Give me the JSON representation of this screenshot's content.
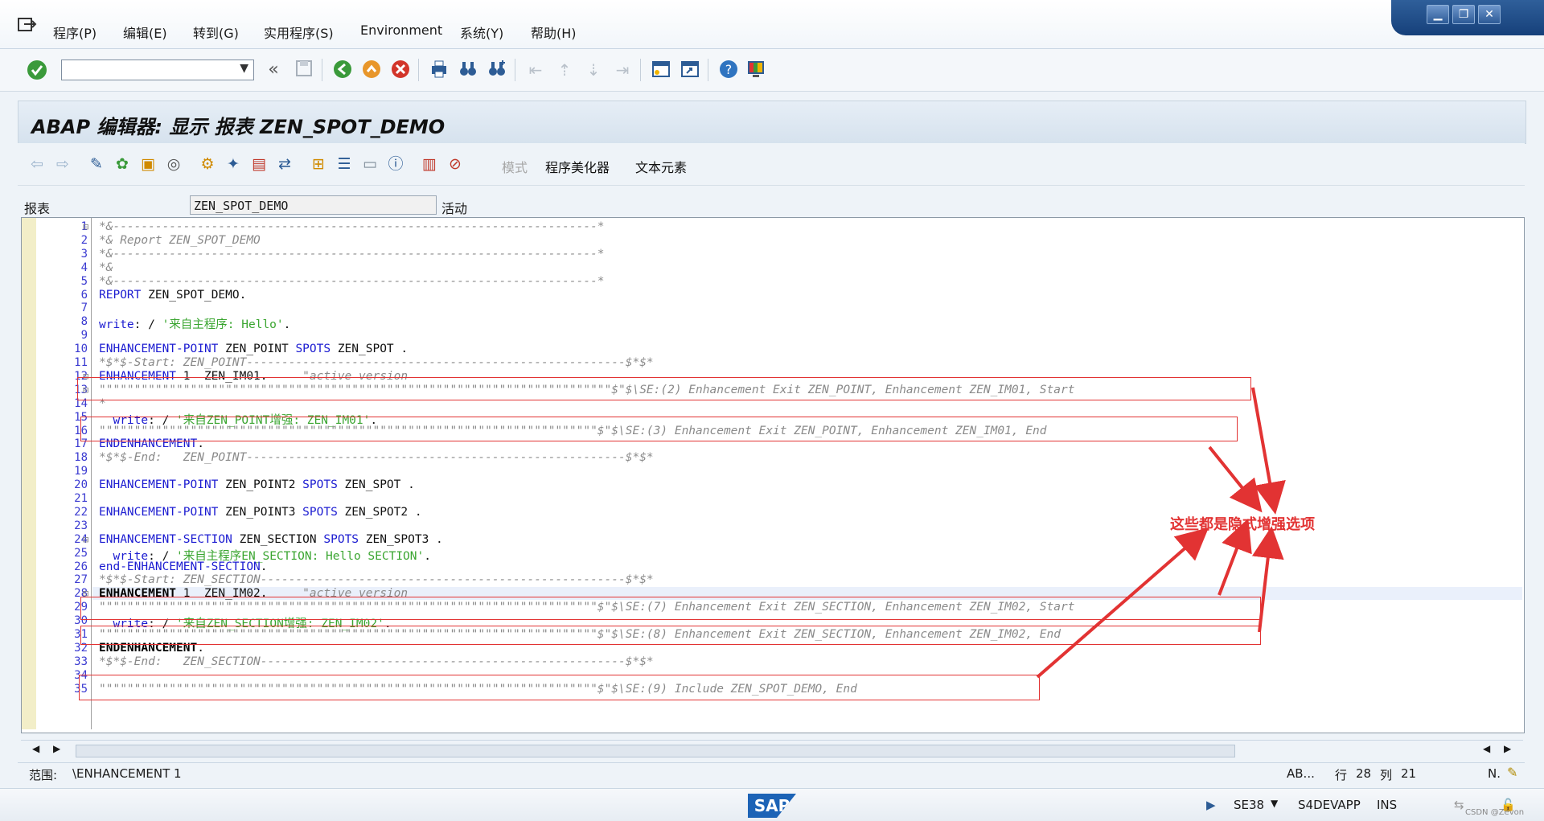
{
  "menu": {
    "items": [
      "程序(P)",
      "编辑(E)",
      "转到(G)",
      "实用程序(S)",
      "Environment",
      "系统(Y)",
      "帮助(H)"
    ]
  },
  "window": {
    "minimize": "▁",
    "restore": "❐",
    "close": "✕"
  },
  "toolbar": {
    "command_placeholder": "",
    "back_double": "«"
  },
  "title": "ABAP 编辑器: 显示 报表 ZEN_SPOT_DEMO",
  "app_toolbar": {
    "mode_label": "模式",
    "pretty_printer_label": "程序美化器",
    "text_elements_label": "文本元素"
  },
  "report": {
    "label": "报表",
    "name": "ZEN_SPOT_DEMO",
    "status": "活动"
  },
  "code_lines": [
    {
      "n": "1",
      "parts": [
        [
          "c",
          "*&---------------------------------------------------------------------*"
        ]
      ]
    },
    {
      "n": "2",
      "parts": [
        [
          "c",
          "*& Report ZEN_SPOT_DEMO"
        ]
      ]
    },
    {
      "n": "3",
      "parts": [
        [
          "c",
          "*&---------------------------------------------------------------------*"
        ]
      ]
    },
    {
      "n": "4",
      "parts": [
        [
          "c",
          "*&"
        ]
      ]
    },
    {
      "n": "5",
      "parts": [
        [
          "c",
          "*&---------------------------------------------------------------------*"
        ]
      ]
    },
    {
      "n": "6",
      "parts": [
        [
          "k",
          "REPORT"
        ],
        [
          "t",
          " ZEN_SPOT_DEMO."
        ]
      ]
    },
    {
      "n": "7",
      "parts": []
    },
    {
      "n": "8",
      "parts": [
        [
          "k",
          "write"
        ],
        [
          "t",
          ": / "
        ],
        [
          "s",
          "'来自主程序: Hello'"
        ],
        [
          "t",
          "."
        ]
      ]
    },
    {
      "n": "9",
      "parts": []
    },
    {
      "n": "10",
      "parts": [
        [
          "k",
          "ENHANCEMENT-POINT"
        ],
        [
          "t",
          " ZEN_POINT "
        ],
        [
          "k",
          "SPOTS"
        ],
        [
          "t",
          " ZEN_SPOT ."
        ]
      ]
    },
    {
      "n": "11",
      "parts": [
        [
          "c",
          "*$*$-Start: ZEN_POINT------------------------------------------------------$*$*"
        ]
      ]
    },
    {
      "n": "12",
      "parts": [
        [
          "k",
          "ENHANCEMENT"
        ],
        [
          "t",
          " 1  ZEN_IM01.     "
        ],
        [
          "c",
          "\"active version"
        ]
      ]
    },
    {
      "n": "13",
      "parts": [
        [
          "c",
          "\"\"\"\"\"\"\"\"\"\"\"\"\"\"\"\"\"\"\"\"\"\"\"\"\"\"\"\"\"\"\"\"\"\"\"\"\"\"\"\"\"\"\"\"\"\"\"\"\"\"\"\"\"\"\"\"\"\"\"\"\"\"\"\"\"\"\"\"\"\"\"\"\"$\"$\\SE:(2) Enhancement Exit ZEN_POINT, Enhancement ZEN_IM01, Start"
        ]
      ]
    },
    {
      "n": "14",
      "parts": [
        [
          "c",
          "*"
        ]
      ]
    },
    {
      "n": "15",
      "parts": [
        [
          "t",
          "  "
        ],
        [
          "k",
          "write"
        ],
        [
          "t",
          ": / "
        ],
        [
          "s",
          "'来自ZEN_POINT增强: ZEN_IM01'"
        ],
        [
          "t",
          "."
        ]
      ]
    },
    {
      "n": "16",
      "parts": [
        [
          "c",
          "\"\"\"\"\"\"\"\"\"\"\"\"\"\"\"\"\"\"\"\"\"\"\"\"\"\"\"\"\"\"\"\"\"\"\"\"\"\"\"\"\"\"\"\"\"\"\"\"\"\"\"\"\"\"\"\"\"\"\"\"\"\"\"\"\"\"\"\"\"\"\"$\"$\\SE:(3) Enhancement Exit ZEN_POINT, Enhancement ZEN_IM01, End"
        ]
      ]
    },
    {
      "n": "17",
      "parts": [
        [
          "k",
          "ENDENHANCEMENT"
        ],
        [
          "t",
          "."
        ]
      ]
    },
    {
      "n": "18",
      "parts": [
        [
          "c",
          "*$*$-End:   ZEN_POINT------------------------------------------------------$*$*"
        ]
      ]
    },
    {
      "n": "19",
      "parts": []
    },
    {
      "n": "20",
      "parts": [
        [
          "k",
          "ENHANCEMENT-POINT"
        ],
        [
          "t",
          " ZEN_POINT2 "
        ],
        [
          "k",
          "SPOTS"
        ],
        [
          "t",
          " ZEN_SPOT ."
        ]
      ]
    },
    {
      "n": "21",
      "parts": []
    },
    {
      "n": "22",
      "parts": [
        [
          "k",
          "ENHANCEMENT-POINT"
        ],
        [
          "t",
          " ZEN_POINT3 "
        ],
        [
          "k",
          "SPOTS"
        ],
        [
          "t",
          " ZEN_SPOT2 ."
        ]
      ]
    },
    {
      "n": "23",
      "parts": []
    },
    {
      "n": "24",
      "parts": [
        [
          "k",
          "ENHANCEMENT-SECTION"
        ],
        [
          "t",
          " ZEN_SECTION "
        ],
        [
          "k",
          "SPOTS"
        ],
        [
          "t",
          " ZEN_SPOT3 ."
        ]
      ]
    },
    {
      "n": "25",
      "parts": [
        [
          "t",
          "  "
        ],
        [
          "k",
          "write"
        ],
        [
          "t",
          ": / "
        ],
        [
          "s",
          "'来自主程序EN_SECTION: Hello SECTION'"
        ],
        [
          "t",
          "."
        ]
      ]
    },
    {
      "n": "26",
      "parts": [
        [
          "k",
          "end-ENHANCEMENT-SECTION"
        ],
        [
          "t",
          "."
        ]
      ]
    },
    {
      "n": "27",
      "parts": [
        [
          "c",
          "*$*$-Start: ZEN_SECTION----------------------------------------------------$*$*"
        ]
      ]
    },
    {
      "n": "28",
      "parts": [
        [
          "b",
          "ENHANCEMENT"
        ],
        [
          "t",
          " 1  ZEN_IM02.     "
        ],
        [
          "c",
          "\"active version"
        ]
      ]
    },
    {
      "n": "29",
      "parts": [
        [
          "c",
          "\"\"\"\"\"\"\"\"\"\"\"\"\"\"\"\"\"\"\"\"\"\"\"\"\"\"\"\"\"\"\"\"\"\"\"\"\"\"\"\"\"\"\"\"\"\"\"\"\"\"\"\"\"\"\"\"\"\"\"\"\"\"\"\"\"\"\"\"\"\"\"$\"$\\SE:(7) Enhancement Exit ZEN_SECTION, Enhancement ZEN_IM02, Start"
        ]
      ]
    },
    {
      "n": "30",
      "parts": [
        [
          "t",
          "  "
        ],
        [
          "k",
          "write"
        ],
        [
          "t",
          ": / "
        ],
        [
          "s",
          "'来自ZEN_SECTION增强: ZEN_IM02'"
        ],
        [
          "t",
          "."
        ]
      ]
    },
    {
      "n": "31",
      "parts": [
        [
          "c",
          "\"\"\"\"\"\"\"\"\"\"\"\"\"\"\"\"\"\"\"\"\"\"\"\"\"\"\"\"\"\"\"\"\"\"\"\"\"\"\"\"\"\"\"\"\"\"\"\"\"\"\"\"\"\"\"\"\"\"\"\"\"\"\"\"\"\"\"\"\"\"\"$\"$\\SE:(8) Enhancement Exit ZEN_SECTION, Enhancement ZEN_IM02, End"
        ]
      ]
    },
    {
      "n": "32",
      "parts": [
        [
          "b",
          "ENDENHANCEMENT"
        ],
        [
          "t",
          "."
        ]
      ]
    },
    {
      "n": "33",
      "parts": [
        [
          "c",
          "*$*$-End:   ZEN_SECTION----------------------------------------------------$*$*"
        ]
      ]
    },
    {
      "n": "34",
      "parts": []
    },
    {
      "n": "35",
      "parts": [
        [
          "c",
          "\"\"\"\"\"\"\"\"\"\"\"\"\"\"\"\"\"\"\"\"\"\"\"\"\"\"\"\"\"\"\"\"\"\"\"\"\"\"\"\"\"\"\"\"\"\"\"\"\"\"\"\"\"\"\"\"\"\"\"\"\"\"\"\"\"\"\"\"\"\"\"$\"$\\SE:(9) Include ZEN_SPOT_DEMO, End"
        ]
      ]
    }
  ],
  "annotation": "这些都是隐式增强选项",
  "scope": {
    "label": "范围:",
    "value": "\\ENHANCEMENT 1",
    "ab": "AB...",
    "row_label": "行",
    "row": "28",
    "col_label": "列",
    "col": "21",
    "mode": "N."
  },
  "statusbar": {
    "logo": "SAP",
    "transaction": "SE38",
    "system": "S4DEVAPP",
    "insert_mode": "INS",
    "watermark": "CSDN @Zevon"
  },
  "colors": {
    "annotation_red": "#e23333",
    "keyword_blue": "#1b1bd1",
    "string_green": "#3aa530",
    "comment_gray": "#8a8a8a"
  }
}
